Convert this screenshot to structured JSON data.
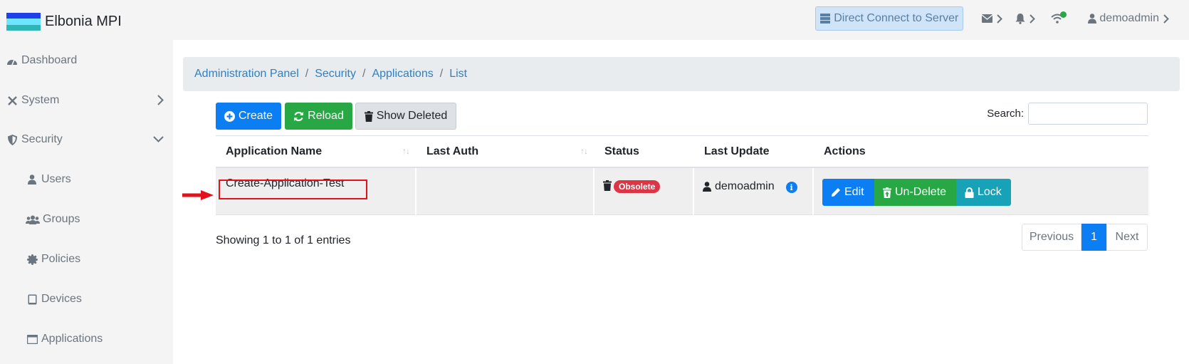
{
  "header": {
    "app_title": "Elbonia MPI",
    "flag_colors": [
      "#1f3fe8",
      "#20c9c9",
      "#2fb5b5"
    ],
    "direct_connect_label": "Direct Connect to Server",
    "user_label": "demoadmin",
    "status_indicator_color": "#28a745"
  },
  "sidebar": {
    "items": [
      {
        "label": "Dashboard",
        "icon": "dashboard-icon"
      },
      {
        "label": "System",
        "icon": "tools-icon",
        "caret": "chevron-right-icon"
      },
      {
        "label": "Security",
        "icon": "shield-icon",
        "caret": "chevron-down-icon"
      },
      {
        "label": "Users",
        "icon": "user-icon"
      },
      {
        "label": "Groups",
        "icon": "users-icon"
      },
      {
        "label": "Policies",
        "icon": "certificate-icon"
      },
      {
        "label": "Devices",
        "icon": "tablet-icon"
      },
      {
        "label": "Applications",
        "icon": "window-icon"
      }
    ]
  },
  "breadcrumb": [
    "Administration Panel",
    "Security",
    "Applications",
    "List"
  ],
  "toolbar": {
    "create_label": "Create",
    "reload_label": "Reload",
    "show_deleted_label": "Show Deleted",
    "search_label": "Search:",
    "search_value": ""
  },
  "table": {
    "columns": [
      "Application Name",
      "Last Auth",
      "Status",
      "Last Update",
      "Actions"
    ],
    "rows": [
      {
        "name": "Create-Application-Test",
        "last_auth": "",
        "status_badge": "Obsolete",
        "last_update_user": "demoadmin",
        "actions": [
          "Edit",
          "Un-Delete",
          "Lock"
        ]
      }
    ]
  },
  "footer": {
    "showing": "Showing 1 to 1 of 1 entries",
    "prev_label": "Previous",
    "page": "1",
    "next_label": "Next"
  },
  "colors": {
    "primary": "#0b7ef3",
    "success": "#28a745",
    "info": "#17a2b8",
    "danger": "#dc3545",
    "annotation": "#e3121a"
  }
}
